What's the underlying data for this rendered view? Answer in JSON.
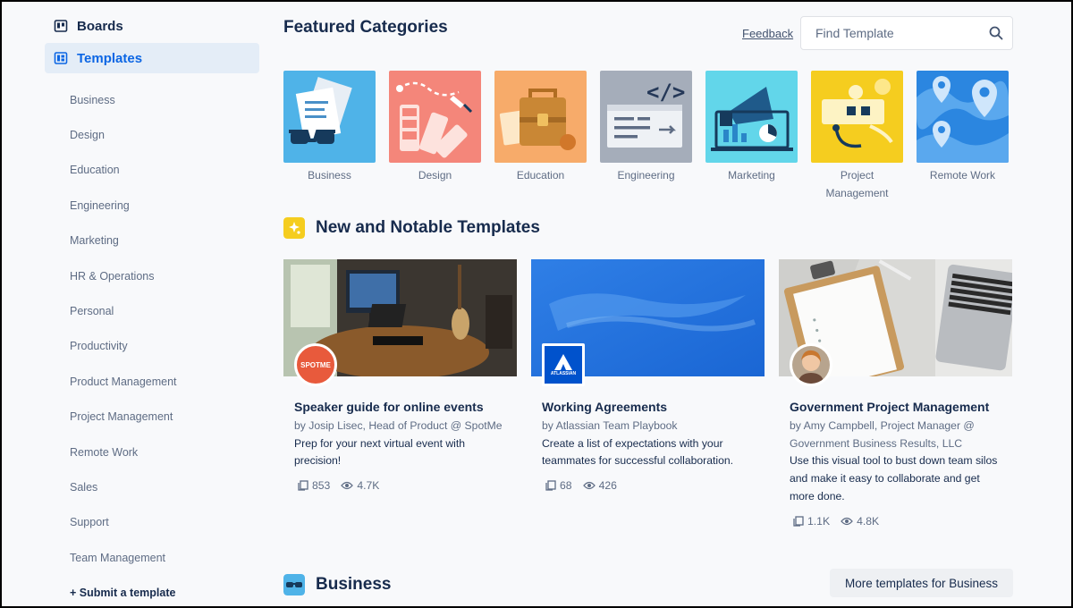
{
  "sidebar": {
    "boards_label": "Boards",
    "templates_label": "Templates",
    "categories": [
      "Business",
      "Design",
      "Education",
      "Engineering",
      "Marketing",
      "HR & Operations",
      "Personal",
      "Productivity",
      "Product Management",
      "Project Management",
      "Remote Work",
      "Sales",
      "Support",
      "Team Management"
    ],
    "submit_label": "+ Submit a template"
  },
  "header": {
    "title": "Featured Categories",
    "feedback_label": "Feedback",
    "search_placeholder": "Find Template"
  },
  "featured": {
    "tiles": [
      {
        "label": "Business",
        "color": "#4fb3e8"
      },
      {
        "label": "Design",
        "color": "#f4867a"
      },
      {
        "label": "Education",
        "color": "#f7ab6a"
      },
      {
        "label": "Engineering",
        "color": "#a5adba"
      },
      {
        "label": "Marketing",
        "color": "#62d6ea"
      },
      {
        "label": "Project Management",
        "color": "#f5cd1f"
      },
      {
        "label": "Remote Work",
        "color": "#2b86e0"
      }
    ]
  },
  "notable": {
    "title": "New and Notable Templates",
    "cards": [
      {
        "title": "Speaker guide for online events",
        "author": "by Josip Lisec, Head of Product @ SpotMe",
        "description": "Prep for your next virtual event with precision!",
        "copies": "853",
        "views": "4.7K",
        "avatar_text": "SPOTME"
      },
      {
        "title": "Working Agreements",
        "author": "by Atlassian Team Playbook",
        "description": "Create a list of expectations with your teammates for successful collaboration.",
        "copies": "68",
        "views": "426",
        "avatar_text": "ATLASSIAN"
      },
      {
        "title": "Government Project Management",
        "author": "by Amy Campbell, Project Manager @ Government Business Results, LLC",
        "description": "Use this visual tool to bust down team silos and make it easy to collaborate and get more done.",
        "copies": "1.1K",
        "views": "4.8K"
      }
    ]
  },
  "business_section": {
    "title": "Business",
    "more_label": "More templates for Business"
  },
  "colors": {
    "accent": "#0c66e4",
    "active_bg": "#e4edf7",
    "text_primary": "#172b4d",
    "text_muted": "#5e6c84"
  }
}
